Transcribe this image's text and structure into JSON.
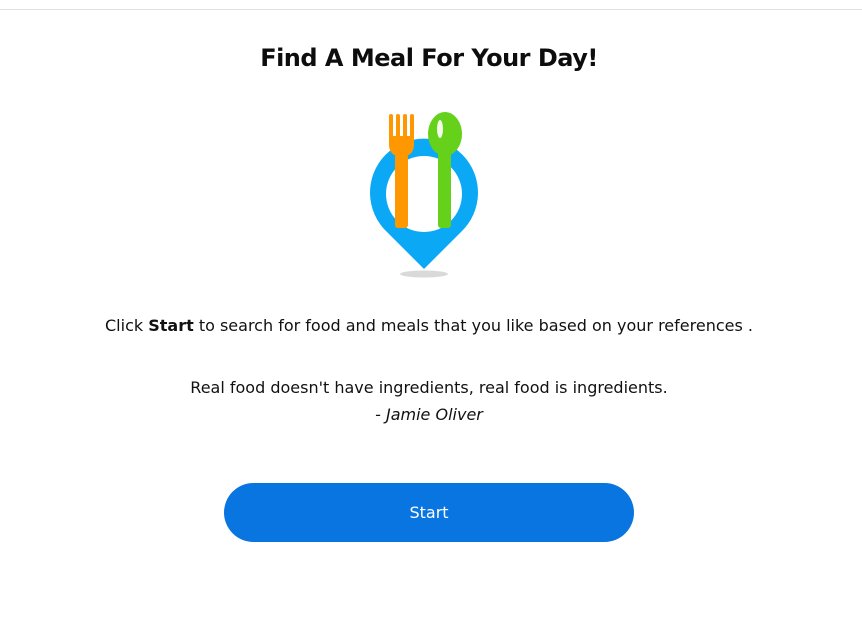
{
  "header": {
    "title": "Find A Meal For Your Day!"
  },
  "logo": {
    "icon": "fork-spoon-location-pin-icon",
    "colors": {
      "pin": "#0aa8f5",
      "fork": "#ff9800",
      "spoon": "#66d11a"
    }
  },
  "intro": {
    "prefix": "Click ",
    "emphasis": "Start",
    "suffix": " to search for food and meals that you like based on your references ."
  },
  "quote": {
    "text": "Real food doesn't have ingredients, real food is ingredients.",
    "author": "- Jamie Oliver"
  },
  "actions": {
    "start_label": "Start",
    "accent": "#0875e0"
  }
}
